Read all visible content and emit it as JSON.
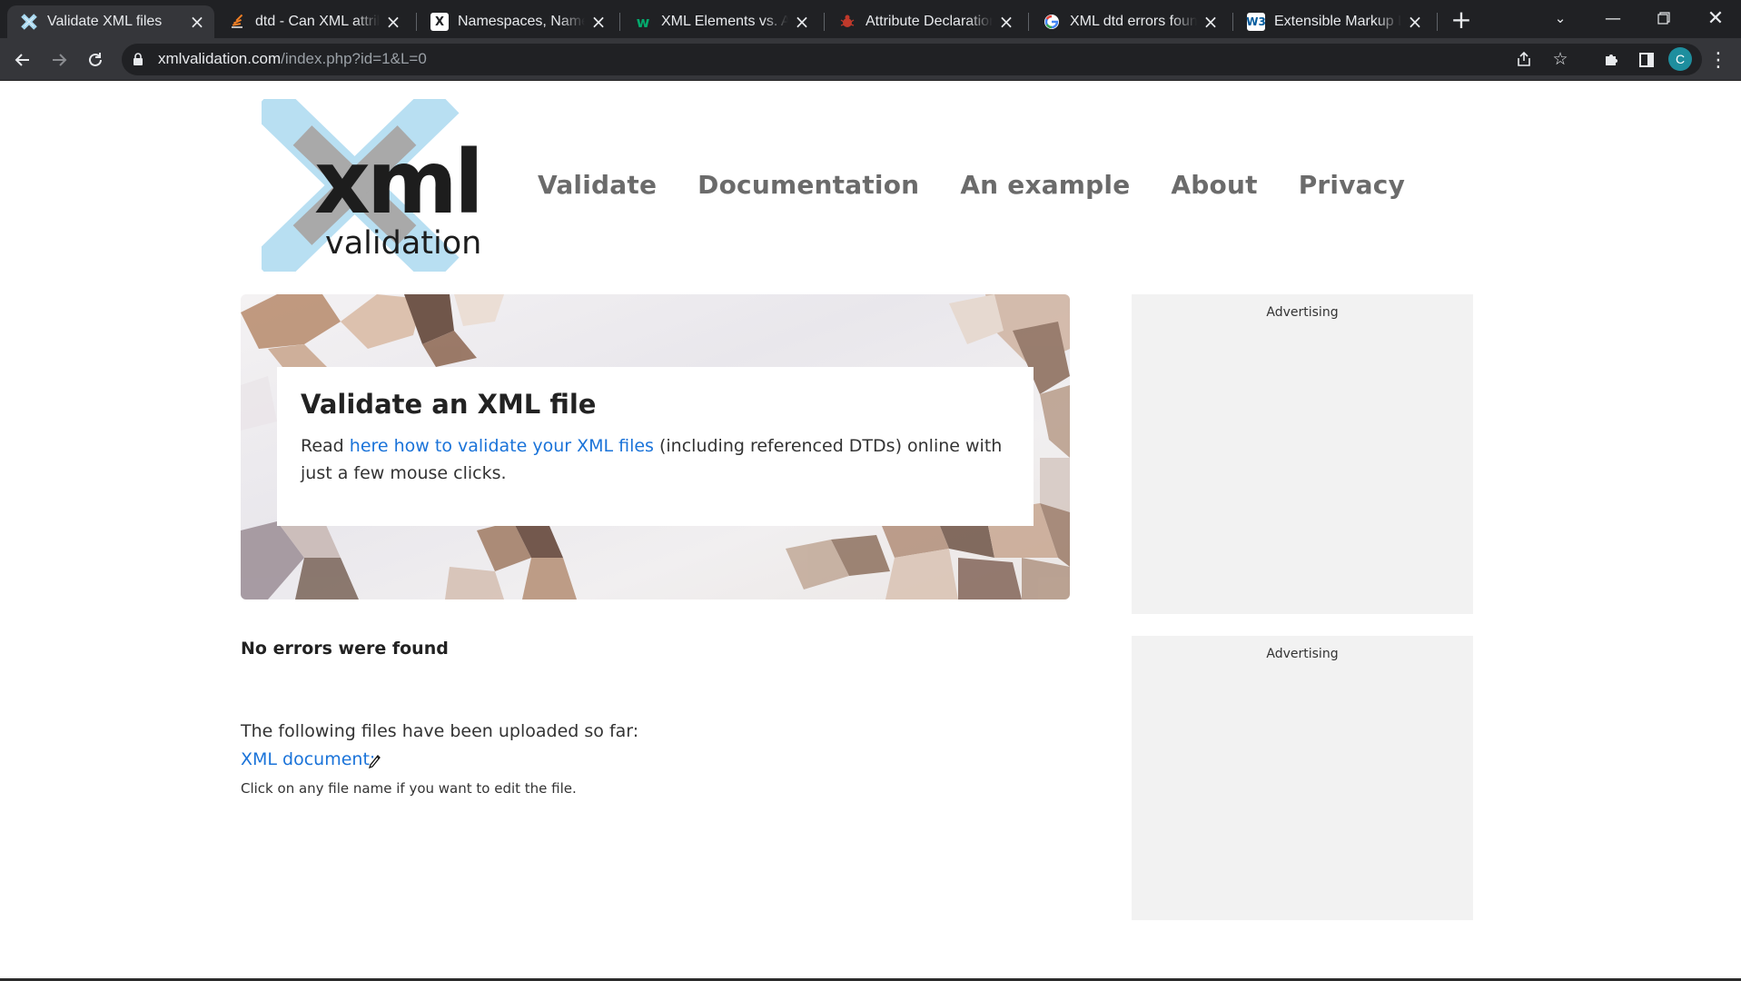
{
  "browser": {
    "tabs": [
      {
        "title": "Validate XML files",
        "icon": "xmlvalidation-favicon"
      },
      {
        "title": "dtd - Can XML attribu",
        "icon": "stackoverflow-favicon"
      },
      {
        "title": "Namespaces, Name W",
        "icon": "x-favicon"
      },
      {
        "title": "XML Elements vs. Attr",
        "icon": "w3schools-favicon"
      },
      {
        "title": "Attribute Declarations",
        "icon": "bug-favicon"
      },
      {
        "title": "XML dtd errors found",
        "icon": "google-favicon"
      },
      {
        "title": "Extensible Markup La",
        "icon": "w3c-favicon"
      }
    ],
    "url_host": "xmlvalidation.com",
    "url_path": "/index.php?id=1&L=0",
    "profile_initial": "C"
  },
  "site": {
    "logo_text_top": "xml",
    "logo_text_bottom": "validation",
    "nav": [
      "Validate",
      "Documentation",
      "An example",
      "About",
      "Privacy"
    ]
  },
  "hero": {
    "title": "Validate an XML file",
    "text_before": "Read ",
    "link_text": "here how to validate your XML files",
    "text_after": " (including referenced DTDs) online with just a few mouse clicks."
  },
  "result": {
    "status": "No errors were found",
    "uploaded_label": "The following files have been uploaded so far:",
    "file_link": "XML document:",
    "hint": "Click on any file name if you want to edit the file."
  },
  "ads": [
    "Advertising",
    "Advertising"
  ],
  "colors": {
    "link": "#1a73d9",
    "nav": "#6b6b6b",
    "ad_bg": "#f2f2f2",
    "logo_blue": "#a8d8f0"
  }
}
